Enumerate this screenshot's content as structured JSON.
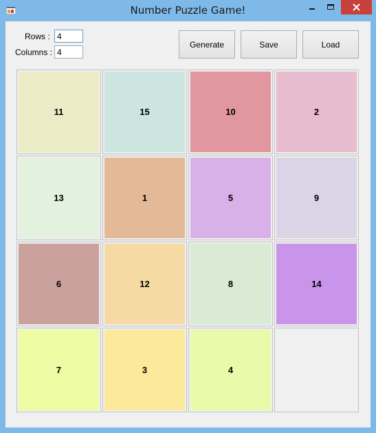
{
  "window": {
    "title": "Number Puzzle Game!",
    "icon": "winforms-app-icon"
  },
  "controls": {
    "rows_label": "Rows :",
    "rows_value": "4",
    "columns_label": "Columns :",
    "columns_value": "4"
  },
  "buttons": {
    "generate": "Generate",
    "save": "Save",
    "load": "Load"
  },
  "board": {
    "rows": 4,
    "columns": 4,
    "tiles": [
      {
        "number": "11",
        "color": "#ebecc6"
      },
      {
        "number": "15",
        "color": "#cde5e0"
      },
      {
        "number": "10",
        "color": "#e0979f"
      },
      {
        "number": "2",
        "color": "#e8bccf"
      },
      {
        "number": "13",
        "color": "#e3f1df"
      },
      {
        "number": "1",
        "color": "#e3b998"
      },
      {
        "number": "5",
        "color": "#d8b1e8"
      },
      {
        "number": "9",
        "color": "#dbd4e7"
      },
      {
        "number": "6",
        "color": "#cba19d"
      },
      {
        "number": "12",
        "color": "#f6daa3"
      },
      {
        "number": "8",
        "color": "#d9ebd5"
      },
      {
        "number": "14",
        "color": "#c995ea"
      },
      {
        "number": "7",
        "color": "#edfca2"
      },
      {
        "number": "3",
        "color": "#fde99b"
      },
      {
        "number": "4",
        "color": "#eafaab"
      },
      {
        "number": "",
        "color": "#f0f0f0",
        "empty": true
      }
    ]
  }
}
